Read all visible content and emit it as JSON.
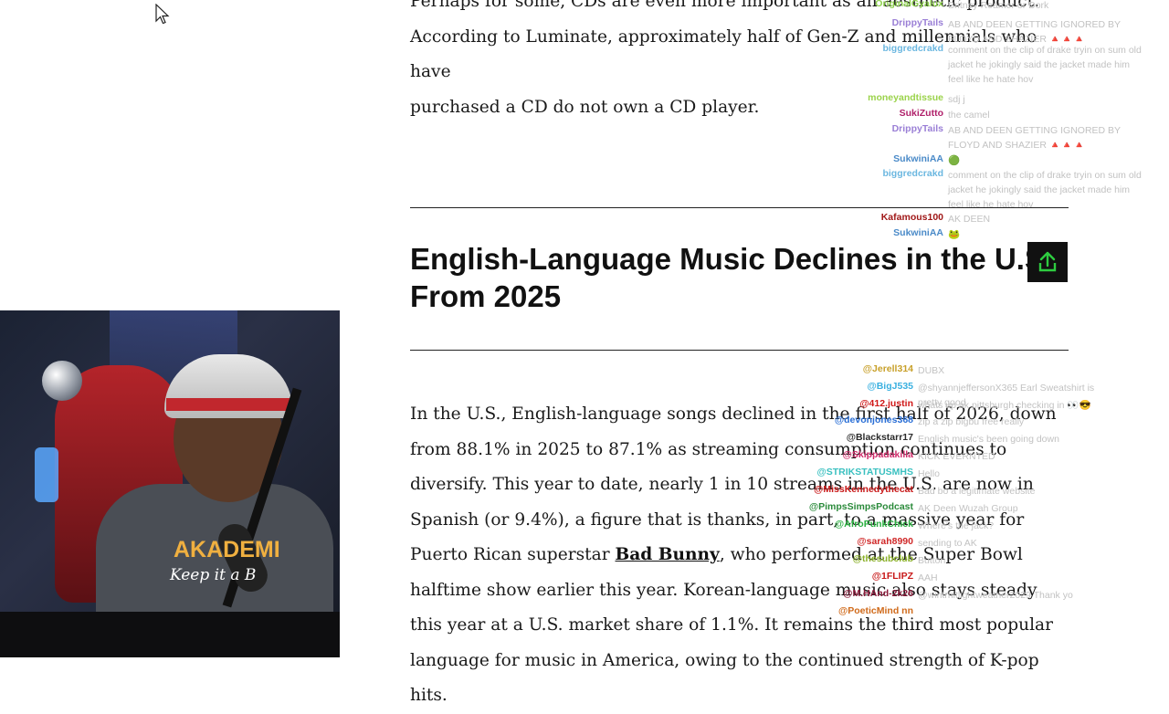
{
  "article": {
    "para1_lines": [
      "Perhaps for some, CDs are even more important as an aesthetic product.",
      "According to Luminate, approximately half of Gen-Z and millennials who have",
      "purchased a CD do not own a CD player."
    ],
    "heading_lines": [
      "English-Language Music Declines in the U.S.",
      "From 2025"
    ],
    "para2": {
      "text_before_link": "In the U.S., English-language songs declined in the first half of 2026, down from 88.1% in 2025 to 87.1% as streaming consumption continues to diversify. This year to date, nearly 1 in 10 streams in the U.S. are now in Spanish (or 9.4%), a figure that is thanks, in part, to a massive year for Puerto Rican superstar ",
      "link_text": "Bad Bunny",
      "text_after_link": ", who performed at the Super Bowl halftime show earlier this year. Korean-language music also stays steady this year at a U.S. market share of 1.1%. It remains the third most popular language for music in America, owing to the continued strength of K-pop hits."
    }
  },
  "share_button": {
    "icon": "share-up-arrow-icon"
  },
  "chat_top": [
    {
      "user": "OriginalGyalux",
      "color": "#8fd14f",
      "msg": "Britney Reamer or Dork"
    },
    {
      "user": "DrippyTails",
      "color": "#9a7fd6",
      "msg": "AB AND DEEN GETTING IGNORED BY FLOYD AND SHAZIER 🔺🔺🔺"
    },
    {
      "user": "biggredcrakd",
      "color": "#6bb7e0",
      "msg": "comment on the clip of drake tryin on sum old jacket he jokingly said the jacket made him feel like he hate hov"
    },
    {
      "user": "moneyandtissue",
      "color": "#9bd34b",
      "msg": "sdj j"
    },
    {
      "user": "SukiZutto",
      "color": "#b0206a",
      "msg": "the camel"
    },
    {
      "user": "DrippyTails",
      "color": "#9a7fd6",
      "msg": "AB AND DEEN GETTING IGNORED BY FLOYD AND SHAZIER 🔺🔺🔺"
    },
    {
      "user": "SukwiniAA",
      "color": "#4a8ac8",
      "msg": "🟢"
    },
    {
      "user": "biggredcrakd",
      "color": "#6bb7e0",
      "msg": "comment on the clip of drake tryin on sum old jacket he jokingly said the jacket made him feel like he hate hov"
    },
    {
      "user": "Kafamous100",
      "color": "#a01818",
      "msg": "AK DEEN"
    },
    {
      "user": "SukwiniAA",
      "color": "#4a8ac8",
      "msg": "🐸"
    }
  ],
  "chat_bottom": [
    {
      "user": "@Jerell314",
      "color": "#c8a02a",
      "msg": "DUBX"
    },
    {
      "user": "@BigJ535",
      "color": "#3ab0e0",
      "msg": "@shyannjeffersonX365 Earl Sweatshirt is pretty good"
    },
    {
      "user": "@412.justin",
      "color": "#d01818",
      "msg": "whats up ak pittsburgh checking in 👀😎"
    },
    {
      "user": "@devonjones368",
      "color": "#2a6fd6",
      "msg": "zip a zip bigbu free really"
    },
    {
      "user": "@Blackstarr17",
      "color": "#2a2a2a",
      "msg": "English music's been going down"
    },
    {
      "user": "@Skippadakilla",
      "color": "#d02c6a",
      "msg": "KICK EVERNTED"
    },
    {
      "user": "@STRIKSTATUSMHS",
      "color": "#3ac0c0",
      "msg": "Hello"
    },
    {
      "user": "@MissKennedythecat",
      "color": "#c81818",
      "msg": "Bad bo a legitimate website"
    },
    {
      "user": "@PimpsSimpsPodcast",
      "color": "#2a8a3a",
      "msg": "AK Deen Wuzah Group"
    },
    {
      "user": "@AfroPunkChick",
      "color": "#2ab040",
      "msg": "Where's the jack?"
    },
    {
      "user": "@sarah8990",
      "color": "#d02828",
      "msg": "sending to AK"
    },
    {
      "user": "@thesubclub",
      "color": "#8ab028",
      "msg": "Button"
    },
    {
      "user": "@1FLIPZ",
      "color": "#c81818",
      "msg": "AAH"
    },
    {
      "user": "@M.HAnd-2k26",
      "color": "#8a1a3a",
      "msg": "@wintrhitlightweather2029 Thank yo"
    },
    {
      "user": "@PoeticMind nn",
      "color": "#d06a1a",
      "msg": ""
    }
  ],
  "webcam": {
    "shirt_text": "AKADEMI",
    "script_text": "Keep it a B"
  }
}
